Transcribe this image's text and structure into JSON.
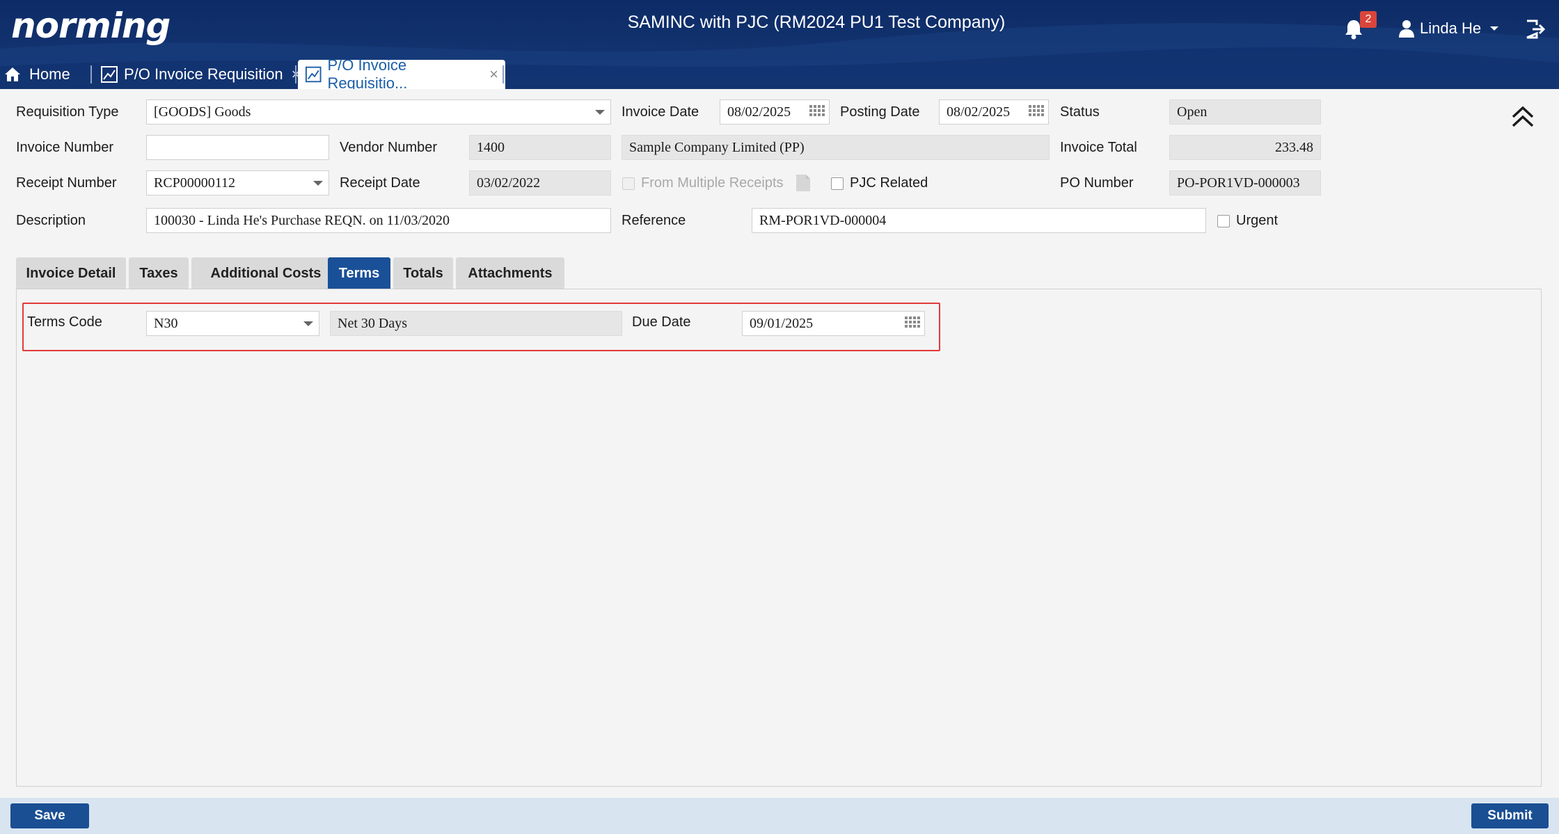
{
  "header": {
    "logo_text": "norming",
    "app_title": "SAMINC with PJC (RM2024 PU1 Test Company)",
    "notification_count": "2",
    "user_name": "Linda He"
  },
  "tabs": {
    "home": "Home",
    "tab1": "P/O Invoice Requisition",
    "tab2": "P/O Invoice Requisitio...",
    "close": "×"
  },
  "form": {
    "requisition_type": {
      "label": "Requisition Type",
      "value": "[GOODS] Goods"
    },
    "invoice_date": {
      "label": "Invoice Date",
      "value": "08/02/2025"
    },
    "posting_date": {
      "label": "Posting Date",
      "value": "08/02/2025"
    },
    "status": {
      "label": "Status",
      "value": "Open"
    },
    "invoice_number": {
      "label": "Invoice Number",
      "value": ""
    },
    "vendor_number": {
      "label": "Vendor Number",
      "value": "1400",
      "name": "Sample Company Limited (PP)"
    },
    "invoice_total": {
      "label": "Invoice Total",
      "value": "233.48"
    },
    "receipt_number": {
      "label": "Receipt Number",
      "value": "RCP00000112"
    },
    "receipt_date": {
      "label": "Receipt Date",
      "value": "03/02/2022"
    },
    "from_multiple_receipts": {
      "label": "From Multiple Receipts",
      "checked": false
    },
    "pjc_related": {
      "label": "PJC Related",
      "checked": false
    },
    "po_number": {
      "label": "PO Number",
      "value": "PO-POR1VD-000003"
    },
    "description": {
      "label": "Description",
      "value": "100030 - Linda He's Purchase REQN. on 11/03/2020"
    },
    "reference": {
      "label": "Reference",
      "value": "RM-POR1VD-000004"
    },
    "urgent": {
      "label": "Urgent",
      "checked": false
    }
  },
  "detail_tabs": [
    {
      "label": "Invoice Detail",
      "active": false
    },
    {
      "label": "Taxes",
      "active": false
    },
    {
      "label": "Additional Costs",
      "active": false
    },
    {
      "label": "Terms",
      "active": true
    },
    {
      "label": "Totals",
      "active": false
    },
    {
      "label": "Attachments",
      "active": false
    }
  ],
  "terms": {
    "terms_code_label": "Terms Code",
    "terms_code": "N30",
    "terms_description": "Net 30 Days",
    "due_date_label": "Due Date",
    "due_date": "09/01/2025"
  },
  "footer": {
    "save_label": "Save",
    "submit_label": "Submit"
  },
  "colors": {
    "header_bg": "#0d2c66",
    "active_tab": "#1a5098",
    "button": "#1a4f93",
    "highlight": "#e23a3a",
    "badge": "#d9453b"
  }
}
